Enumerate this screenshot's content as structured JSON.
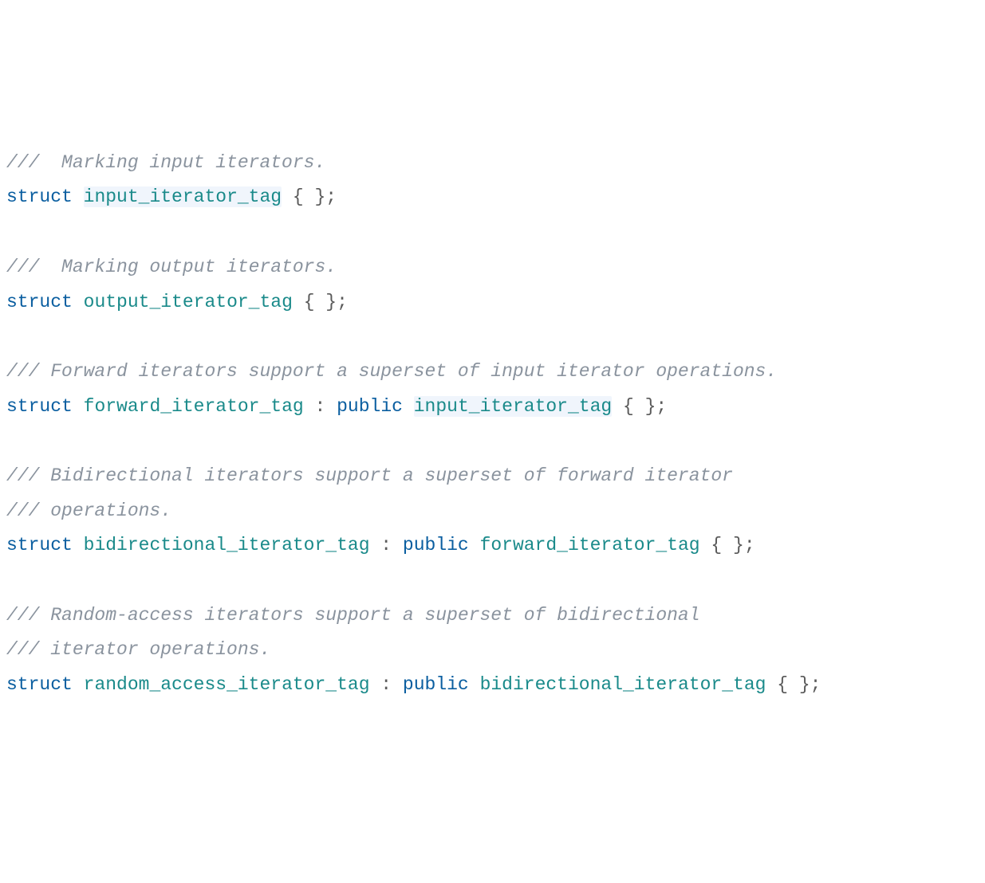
{
  "lines": [
    {
      "segments": [
        {
          "text": "///  Marking input iterators.",
          "cls": "comment"
        }
      ]
    },
    {
      "segments": [
        {
          "text": "struct",
          "cls": "keyword"
        },
        {
          "text": " ",
          "cls": ""
        },
        {
          "text": "input_iterator_tag",
          "cls": "type highlight"
        },
        {
          "text": " { };",
          "cls": "punct"
        }
      ]
    },
    {
      "segments": [
        {
          "text": "",
          "cls": ""
        }
      ]
    },
    {
      "segments": [
        {
          "text": "///  Marking output iterators.",
          "cls": "comment"
        }
      ]
    },
    {
      "segments": [
        {
          "text": "struct",
          "cls": "keyword"
        },
        {
          "text": " ",
          "cls": ""
        },
        {
          "text": "output_iterator_tag",
          "cls": "type"
        },
        {
          "text": " { };",
          "cls": "punct"
        }
      ]
    },
    {
      "segments": [
        {
          "text": "",
          "cls": ""
        }
      ]
    },
    {
      "segments": [
        {
          "text": "/// Forward iterators support a superset of input iterator operations.",
          "cls": "comment"
        }
      ]
    },
    {
      "segments": [
        {
          "text": "struct",
          "cls": "keyword"
        },
        {
          "text": " ",
          "cls": ""
        },
        {
          "text": "forward_iterator_tag",
          "cls": "type"
        },
        {
          "text": " : ",
          "cls": "punct"
        },
        {
          "text": "public",
          "cls": "keyword"
        },
        {
          "text": " ",
          "cls": ""
        },
        {
          "text": "input_iterator_tag",
          "cls": "type highlight"
        },
        {
          "text": " { };",
          "cls": "punct"
        }
      ]
    },
    {
      "segments": [
        {
          "text": "",
          "cls": ""
        }
      ]
    },
    {
      "segments": [
        {
          "text": "/// Bidirectional iterators support a superset of forward iterator",
          "cls": "comment"
        }
      ]
    },
    {
      "segments": [
        {
          "text": "/// operations.",
          "cls": "comment"
        }
      ]
    },
    {
      "segments": [
        {
          "text": "struct",
          "cls": "keyword"
        },
        {
          "text": " ",
          "cls": ""
        },
        {
          "text": "bidirectional_iterator_tag",
          "cls": "type"
        },
        {
          "text": " : ",
          "cls": "punct"
        },
        {
          "text": "public",
          "cls": "keyword"
        },
        {
          "text": " ",
          "cls": ""
        },
        {
          "text": "forward_iterator_tag",
          "cls": "type"
        },
        {
          "text": " { };",
          "cls": "punct"
        }
      ]
    },
    {
      "segments": [
        {
          "text": "",
          "cls": ""
        }
      ]
    },
    {
      "segments": [
        {
          "text": "/// Random-access iterators support a superset of bidirectional",
          "cls": "comment"
        }
      ]
    },
    {
      "segments": [
        {
          "text": "/// iterator operations.",
          "cls": "comment"
        }
      ]
    },
    {
      "segments": [
        {
          "text": "struct",
          "cls": "keyword"
        },
        {
          "text": " ",
          "cls": ""
        },
        {
          "text": "random_access_iterator_tag",
          "cls": "type"
        },
        {
          "text": " : ",
          "cls": "punct"
        },
        {
          "text": "public",
          "cls": "keyword"
        },
        {
          "text": " ",
          "cls": ""
        },
        {
          "text": "bidirectional_iterator_tag",
          "cls": "type"
        },
        {
          "text": " { };",
          "cls": "punct"
        }
      ]
    }
  ]
}
